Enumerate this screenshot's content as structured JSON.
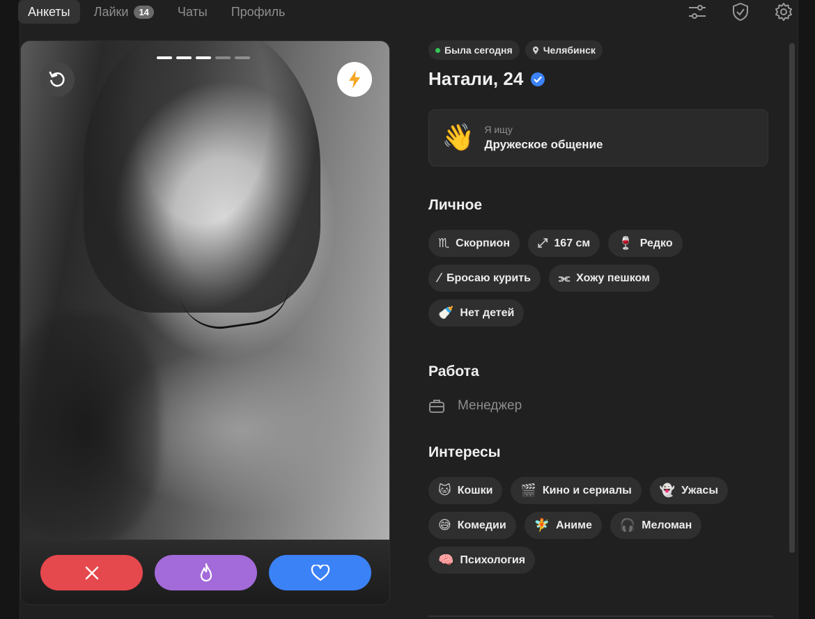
{
  "nav": {
    "tabs": [
      {
        "label": "Анкеты"
      },
      {
        "label": "Лайки",
        "badge": "14"
      },
      {
        "label": "Чаты"
      },
      {
        "label": "Профиль"
      }
    ],
    "icons": [
      "filters-icon",
      "shield-check-icon",
      "settings-gear-icon"
    ]
  },
  "photo": {
    "progress_total": 5,
    "progress_current": 3
  },
  "actions": {
    "icons": [
      "close-icon",
      "flame-icon",
      "heart-icon"
    ],
    "colors": {
      "dislike": "#e5484d",
      "super": "#a36ad9",
      "like": "#3b82f6"
    }
  },
  "profile": {
    "status": "Была сегодня",
    "city": "Челябинск",
    "name_age": "Натали, 24",
    "looking_caption": "Я ищу",
    "looking_value": "Дружеское общение",
    "looking_emoji": "👋",
    "personal_title": "Личное",
    "personal": [
      {
        "icon": "♏",
        "label": "Скорпион"
      },
      {
        "icon": "⤢",
        "label": "167 см"
      },
      {
        "icon": "🍷",
        "label": "Редко"
      },
      {
        "icon": "⁄",
        "label": "Бросаю курить"
      },
      {
        "icon": "⫘",
        "label": "Хожу пешком"
      },
      {
        "icon": "🍼",
        "label": "Нет детей"
      }
    ],
    "work_title": "Работа",
    "work": "Менеджер",
    "interests_title": "Интересы",
    "interests": [
      {
        "icon": "🐱",
        "label": "Кошки"
      },
      {
        "icon": "🎬",
        "label": "Кино и сериалы"
      },
      {
        "icon": "👻",
        "label": "Ужасы"
      },
      {
        "icon": "😅",
        "label": "Комедии"
      },
      {
        "icon": "🧚",
        "label": "Аниме"
      },
      {
        "icon": "🎧",
        "label": "Меломан"
      },
      {
        "icon": "🧠",
        "label": "Психология"
      }
    ]
  }
}
